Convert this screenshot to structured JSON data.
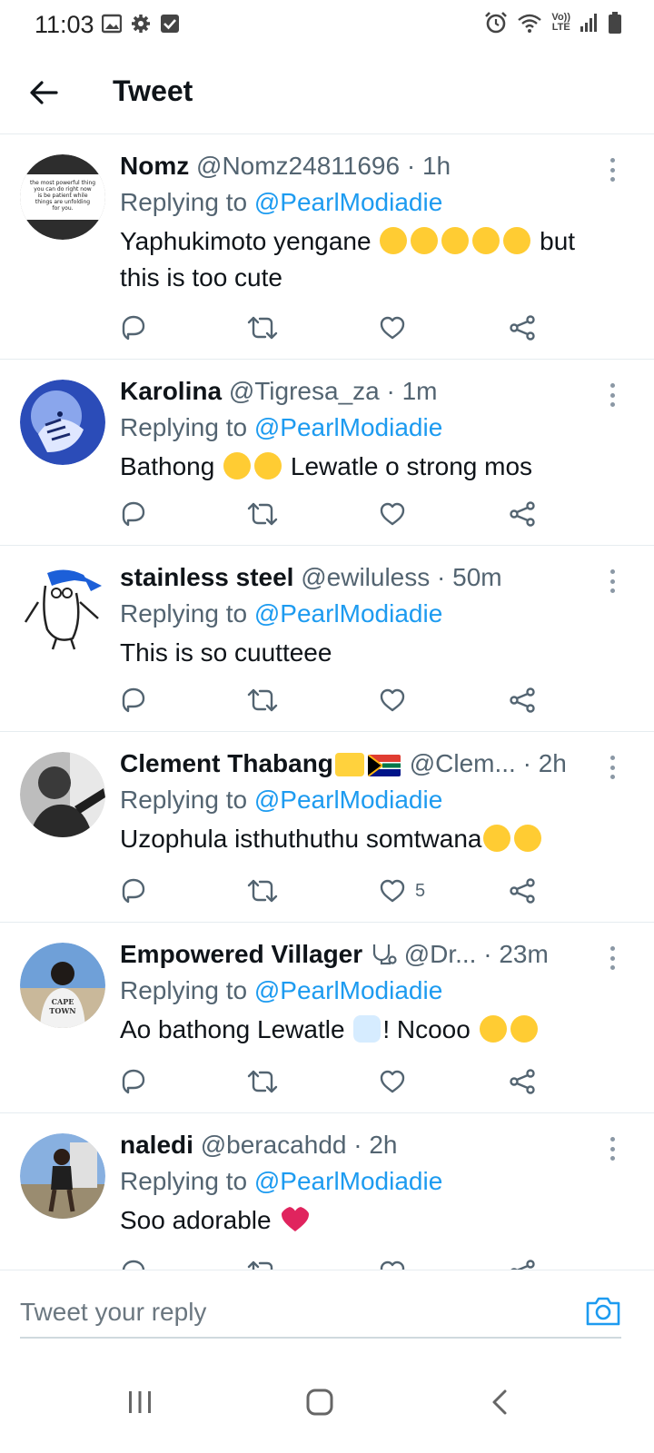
{
  "status_bar": {
    "time": "11:03",
    "left_icons": [
      "image-icon",
      "gear-icon",
      "checkbox-icon"
    ],
    "right_icons": [
      "alarm-icon",
      "wifi-icon",
      "volte-icon",
      "signal-icon",
      "battery-icon"
    ],
    "volte_label_top": "Vo))",
    "volte_label_bottom": "LTE"
  },
  "header": {
    "title": "Tweet"
  },
  "replies": [
    {
      "name": "Nomz",
      "handle": "@Nomz24811696",
      "time": "· 1h",
      "replying_prefix": "Replying to ",
      "replying_to": "@PearlModiadie",
      "text": "Yaphukimoto yengane",
      "text_suffix": " but this is too cute",
      "likes": ""
    },
    {
      "name": "Karolina",
      "handle": "@Tigresa_za",
      "time": "· 1m",
      "replying_prefix": "Replying to ",
      "replying_to": "@PearlModiadie",
      "text": "Bathong",
      "text_suffix": " Lewatle o strong mos",
      "likes": ""
    },
    {
      "name": "stainless steel",
      "handle": "@ewiluless",
      "time": "· 50m",
      "replying_prefix": "Replying to ",
      "replying_to": "@PearlModiadie",
      "text": "This is so cuutteee",
      "likes": ""
    },
    {
      "name": "Clement Thabang",
      "handle": "@Clem...",
      "time": "· 2h",
      "replying_prefix": "Replying to ",
      "replying_to": "@PearlModiadie",
      "text": "Uzophula isthuthuthu somtwana",
      "likes": "5"
    },
    {
      "name": "Empowered Villager",
      "handle": "@Dr...",
      "time": "· 23m",
      "replying_prefix": "Replying to ",
      "replying_to": "@PearlModiadie",
      "text": "Ao bathong Lewatle",
      "text_suffix": "! Ncooo",
      "likes": ""
    },
    {
      "name": "naledi",
      "handle": "@beracahdd",
      "time": "· 2h",
      "replying_prefix": "Replying to ",
      "replying_to": "@PearlModiadie",
      "text": "Soo adorable",
      "likes": ""
    }
  ],
  "avatar_1_lines": [
    "the most powerful thing",
    "you can do right now",
    "is be patient while",
    "things are unfolding",
    "for you."
  ],
  "avatar_5_lines": [
    "CAPE",
    "TOWN"
  ],
  "reply_bar": {
    "placeholder": "Tweet your reply"
  },
  "colors": {
    "accent": "#1d9bf0",
    "text_primary": "#0f1419",
    "text_secondary": "#536471",
    "divider": "#e6ecf0"
  }
}
